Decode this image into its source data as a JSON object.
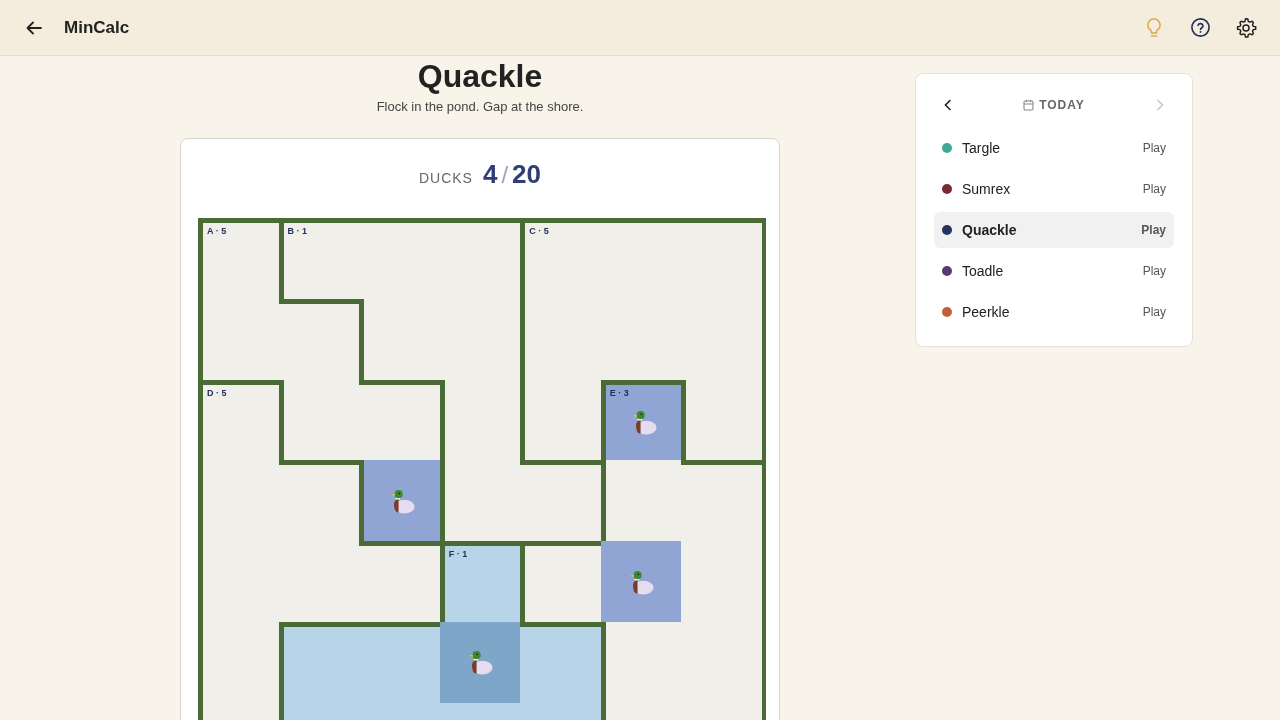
{
  "app_bar": {
    "title": "MinCalc"
  },
  "puzzle": {
    "title": "Quackle",
    "subtitle": "Flock in the pond. Gap at the shore.",
    "counter_label": "DUCKS",
    "placed": "4",
    "separator": "/",
    "total": "20"
  },
  "grid": [
    [
      {
        "label": "A · 5",
        "wall_top": true,
        "wall_left": true,
        "duck": false,
        "pond": false
      },
      {
        "label": "B · 1",
        "wall_top": true,
        "wall_left": true,
        "duck": false,
        "pond": false
      },
      {
        "wall_top": true,
        "wall_left": false,
        "duck": false,
        "pond": false
      },
      {
        "wall_top": true,
        "wall_left": false,
        "duck": false,
        "pond": false
      },
      {
        "label": "C · 5",
        "wall_top": true,
        "wall_left": true,
        "duck": false,
        "pond": false
      },
      {
        "wall_top": true,
        "wall_left": false,
        "duck": false,
        "pond": false
      },
      {
        "wall_top": true,
        "wall_left": false,
        "duck": false,
        "pond": false
      }
    ],
    [
      {
        "wall_top": false,
        "wall_left": true,
        "duck": false,
        "pond": false
      },
      {
        "wall_top": true,
        "wall_left": false,
        "duck": false,
        "pond": false
      },
      {
        "wall_top": false,
        "wall_left": true,
        "duck": false,
        "pond": false
      },
      {
        "wall_top": false,
        "wall_left": false,
        "duck": false,
        "pond": false
      },
      {
        "wall_top": false,
        "wall_left": true,
        "duck": false,
        "pond": false
      },
      {
        "wall_top": false,
        "wall_left": false,
        "duck": false,
        "pond": false
      },
      {
        "wall_top": false,
        "wall_left": false,
        "duck": false,
        "pond": false
      }
    ],
    [
      {
        "label": "D · 5",
        "wall_top": true,
        "wall_left": true,
        "duck": false,
        "pond": false
      },
      {
        "wall_top": false,
        "wall_left": true,
        "duck": false,
        "pond": false
      },
      {
        "wall_top": true,
        "wall_left": false,
        "duck": false,
        "pond": false
      },
      {
        "wall_top": false,
        "wall_left": true,
        "duck": false,
        "pond": false
      },
      {
        "wall_top": false,
        "wall_left": true,
        "duck": false,
        "pond": false
      },
      {
        "label": "E · 3",
        "wall_top": true,
        "wall_left": true,
        "duck": true,
        "pond": false
      },
      {
        "wall_top": false,
        "wall_left": true,
        "duck": false,
        "pond": false
      }
    ],
    [
      {
        "wall_top": false,
        "wall_left": true,
        "duck": false,
        "pond": false
      },
      {
        "wall_top": true,
        "wall_left": false,
        "duck": false,
        "pond": false
      },
      {
        "wall_top": false,
        "wall_left": true,
        "duck": true,
        "pond": false
      },
      {
        "wall_top": false,
        "wall_left": true,
        "duck": false,
        "pond": false
      },
      {
        "wall_top": true,
        "wall_left": false,
        "duck": false,
        "pond": false
      },
      {
        "wall_top": false,
        "wall_left": true,
        "duck": false,
        "pond": false
      },
      {
        "wall_top": true,
        "wall_left": false,
        "duck": false,
        "pond": false
      }
    ],
    [
      {
        "wall_top": false,
        "wall_left": true,
        "duck": false,
        "pond": false
      },
      {
        "wall_top": false,
        "wall_left": false,
        "duck": false,
        "pond": false
      },
      {
        "wall_top": true,
        "wall_left": false,
        "duck": false,
        "pond": false
      },
      {
        "label": "F · 1",
        "wall_top": true,
        "wall_left": true,
        "duck": false,
        "pond": true
      },
      {
        "wall_top": true,
        "wall_left": true,
        "duck": false,
        "pond": false
      },
      {
        "wall_top": false,
        "wall_left": false,
        "duck": true,
        "pond": false
      },
      {
        "wall_top": false,
        "wall_left": false,
        "duck": false,
        "pond": false
      }
    ],
    [
      {
        "wall_top": false,
        "wall_left": true,
        "duck": false,
        "pond": false
      },
      {
        "wall_top": true,
        "wall_left": true,
        "duck": false,
        "pond": true
      },
      {
        "wall_top": true,
        "wall_left": false,
        "duck": false,
        "pond": true
      },
      {
        "wall_top": false,
        "wall_left": false,
        "duck": true,
        "pond": true
      },
      {
        "wall_top": true,
        "wall_left": false,
        "duck": false,
        "pond": true
      },
      {
        "wall_top": false,
        "wall_left": true,
        "duck": false,
        "pond": false
      },
      {
        "wall_top": false,
        "wall_left": false,
        "duck": false,
        "pond": false
      }
    ],
    [
      {
        "wall_top": false,
        "wall_left": true,
        "duck": false,
        "pond": false
      },
      {
        "wall_top": false,
        "wall_left": true,
        "duck": false,
        "pond": true
      },
      {
        "wall_top": false,
        "wall_left": false,
        "duck": false,
        "pond": true
      },
      {
        "wall_top": false,
        "wall_left": false,
        "duck": false,
        "pond": true
      },
      {
        "wall_top": false,
        "wall_left": false,
        "duck": false,
        "pond": true
      },
      {
        "wall_top": false,
        "wall_left": true,
        "duck": false,
        "pond": false
      },
      {
        "wall_top": false,
        "wall_left": false,
        "duck": false,
        "pond": false
      }
    ]
  ],
  "schedule": {
    "heading": "TODAY",
    "prev_disabled": false,
    "next_disabled": true,
    "games": [
      {
        "name": "Targle",
        "action": "Play",
        "color": "#3fa796",
        "selected": false
      },
      {
        "name": "Sumrex",
        "action": "Play",
        "color": "#7a2a36",
        "selected": false
      },
      {
        "name": "Quackle",
        "action": "Play",
        "color": "#253262",
        "selected": true
      },
      {
        "name": "Toadle",
        "action": "Play",
        "color": "#5a3a72",
        "selected": false
      },
      {
        "name": "Peerkle",
        "action": "Play",
        "color": "#c0603a",
        "selected": false
      }
    ]
  }
}
